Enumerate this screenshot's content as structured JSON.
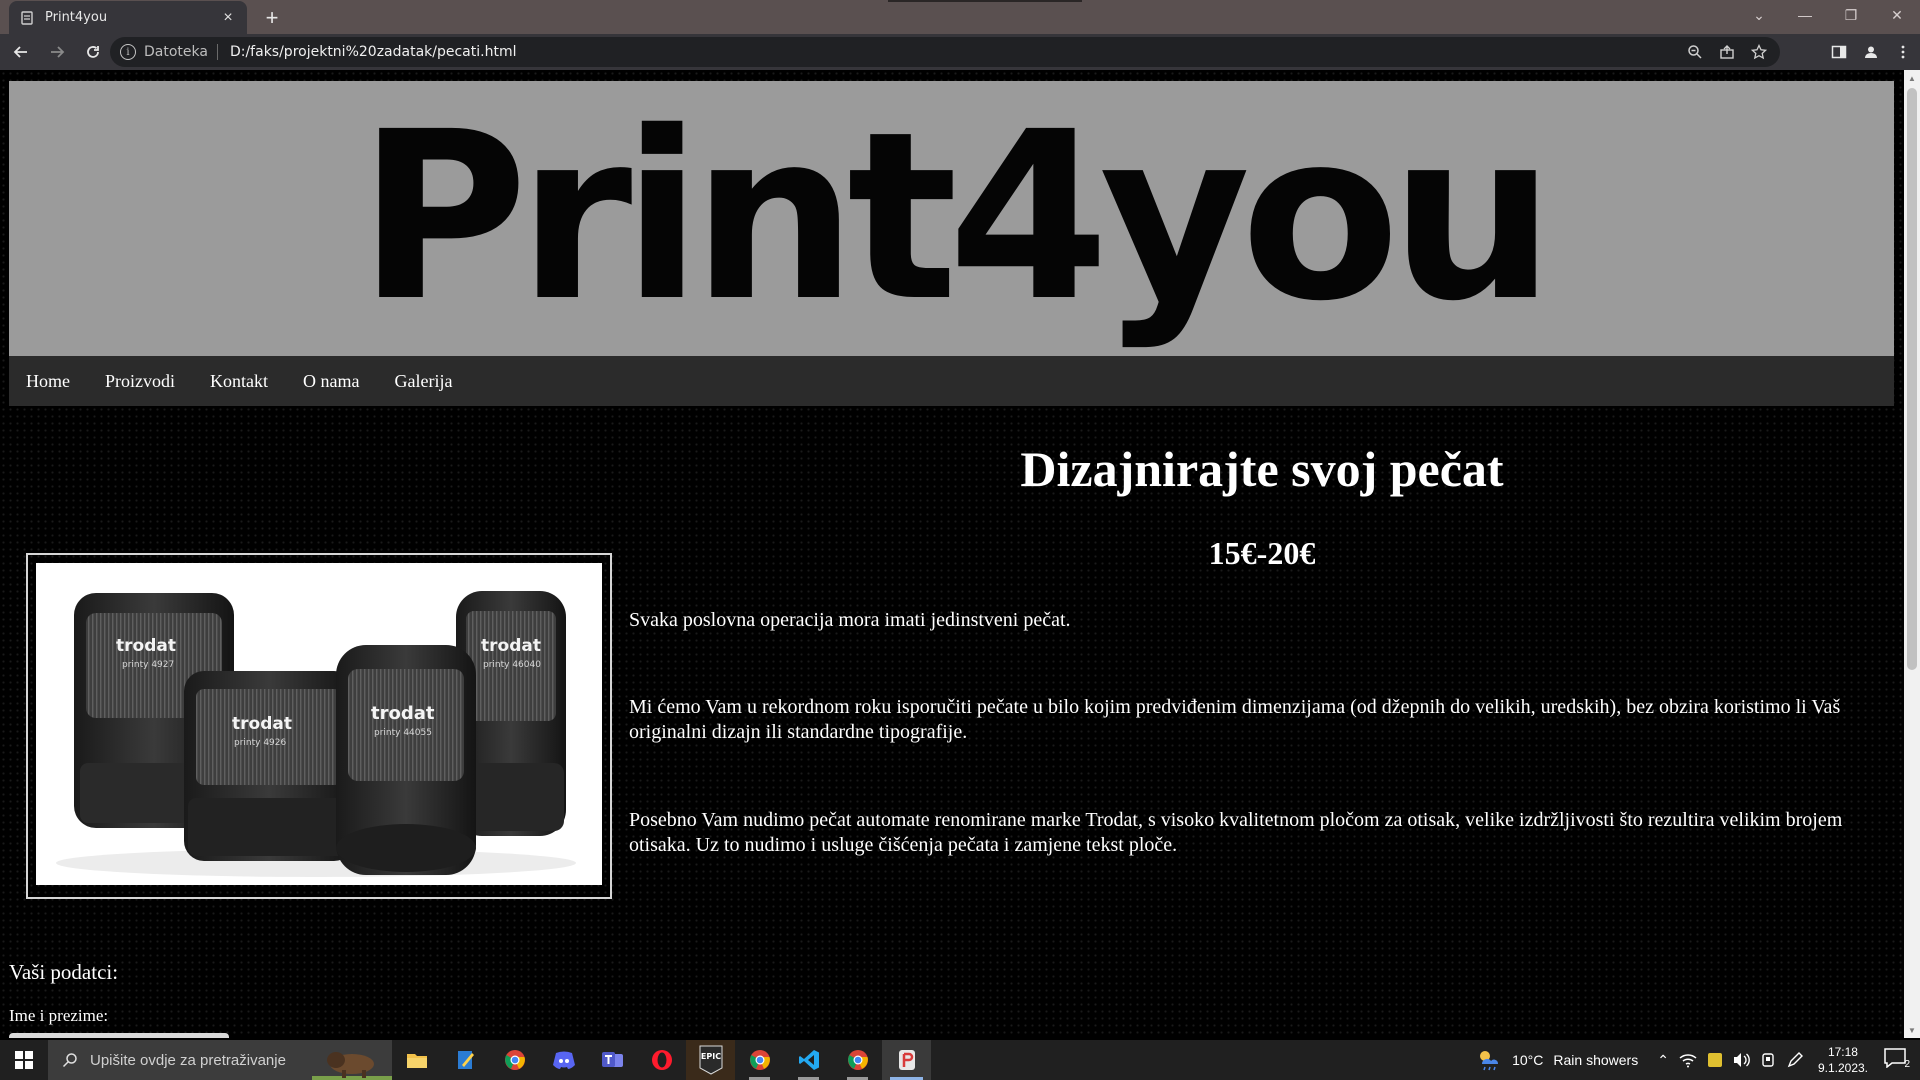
{
  "browser": {
    "tab_title": "Print4you",
    "tab_close": "×",
    "new_tab": "+",
    "address_scheme": "Datoteka",
    "address_url": "D:/faks/projektni%20zadatak/pecati.html"
  },
  "page": {
    "logo": "Print4you",
    "nav": [
      "Home",
      "Proizvodi",
      "Kontakt",
      "O nama",
      "Galerija"
    ],
    "title": "Dizajnirajte svoj pečat",
    "price": "15€-20€",
    "paragraphs": [
      "Svaka poslovna operacija mora imati jedinstveni pečat.",
      "Mi ćemo Vam u rekordnom roku isporučiti pečate u bilo kojim predviđenim dimenzijama (od džepnih do velikih, uredskih), bez obzira koristimo li Vaš originalni dizajn ili standardne tipografije.",
      "Posebno Vam nudimo pečat automate renomirane marke Trodat, s visoko kvalitetnom pločom za otisak, velike izdržljivosti što rezultira velikim brojem otisaka. Uz to nudimo i usluge čišćenja pečata i zamjene tekst ploče."
    ],
    "image_labels": [
      "trodat",
      "trodat",
      "trodat",
      "trodat"
    ],
    "image_model_labels": [
      "printy 4927",
      "printy 4926",
      "printy 44055",
      "printy 46040"
    ],
    "form_title": "Vaši podatci:",
    "form_name_label": "Ime i prezime:"
  },
  "taskbar": {
    "search_placeholder": "Upišite ovdje za pretraživanje",
    "epic_label": "EPIC",
    "weather_temp": "10°C",
    "weather_desc": "Rain showers",
    "time": "17:18",
    "date": "9.1.2023.",
    "notification_count": "2"
  },
  "colors": {
    "banner": "#9b9b9b",
    "navbar": "#2b2b2b",
    "page_bg": "#000000",
    "taskbar": "#202020"
  }
}
